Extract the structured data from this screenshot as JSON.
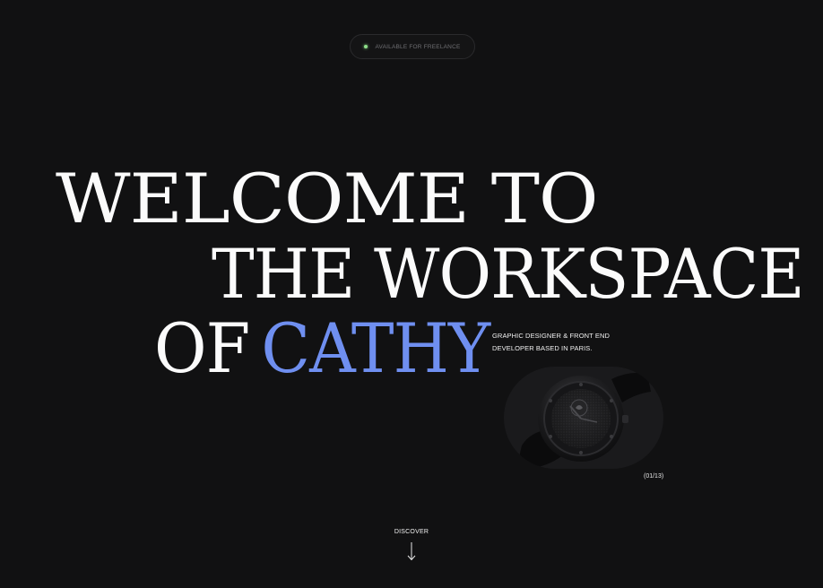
{
  "status": {
    "label": "AVAILABLE FOR FREELANCE",
    "dot_color": "#8ee08a"
  },
  "hero": {
    "line1": "WELCOME TO",
    "line2": "THE WORKSPACE",
    "line3_prefix": "OF",
    "line3_name": "CATHY",
    "accent_color": "#6f8ff0"
  },
  "tagline": {
    "line1": "GRAPHIC DESIGNER & FRONT END",
    "line2": "DEVELOPER BASED IN PARIS."
  },
  "showcase": {
    "image": "black-wristwatch-image",
    "counter": "(01/13)"
  },
  "discover": {
    "label": "DISCOVER",
    "icon": "arrow-down-icon"
  }
}
